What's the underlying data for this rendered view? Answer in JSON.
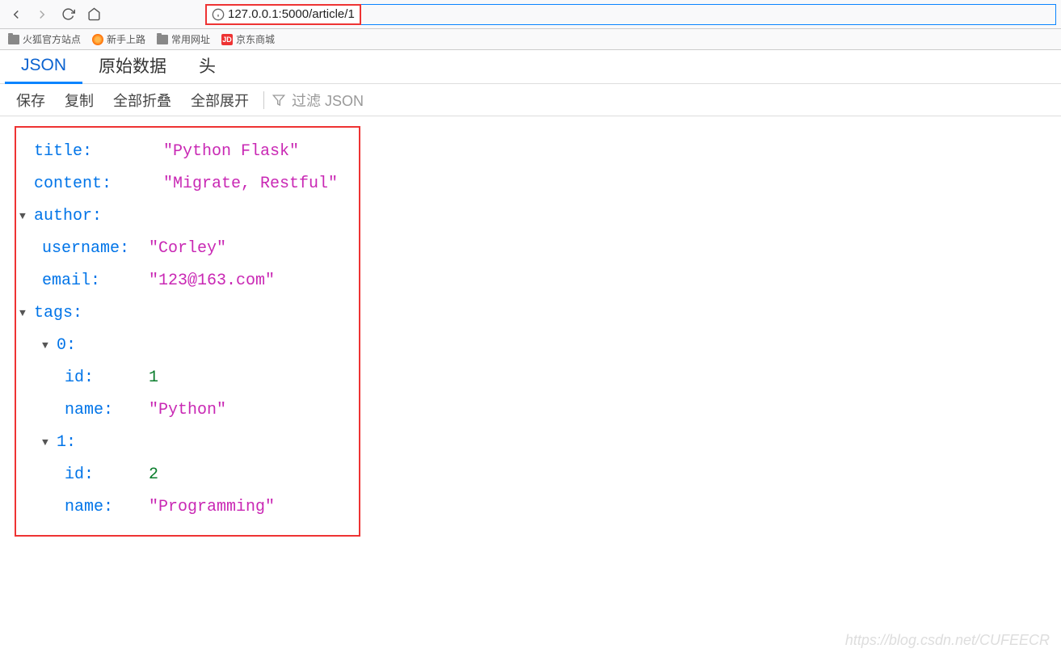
{
  "nav": {
    "url": "127.0.0.1:5000/article/1"
  },
  "bookmarks": {
    "b1": "火狐官方站点",
    "b2": "新手上路",
    "b3": "常用网址",
    "b4": "京东商城",
    "jd": "JD"
  },
  "tabs": {
    "json": "JSON",
    "raw": "原始数据",
    "headers": "头"
  },
  "actions": {
    "save": "保存",
    "copy": "复制",
    "collapse": "全部折叠",
    "expand": "全部展开",
    "filter": "过滤 JSON"
  },
  "json": {
    "k_title": "title",
    "v_title": "\"Python Flask\"",
    "k_content": "content",
    "v_content": "\"Migrate, Restful\"",
    "k_author": "author",
    "k_username": "username",
    "v_username": "\"Corley\"",
    "k_email": "email",
    "v_email": "\"123@163.com\"",
    "k_tags": "tags",
    "k_0": "0",
    "k_1": "1",
    "k_id": "id",
    "k_name": "name",
    "v_id0": "1",
    "v_name0": "\"Python\"",
    "v_id1": "2",
    "v_name1": "\"Programming\"",
    "colon": ":"
  },
  "watermark": "https://blog.csdn.net/CUFEECR"
}
